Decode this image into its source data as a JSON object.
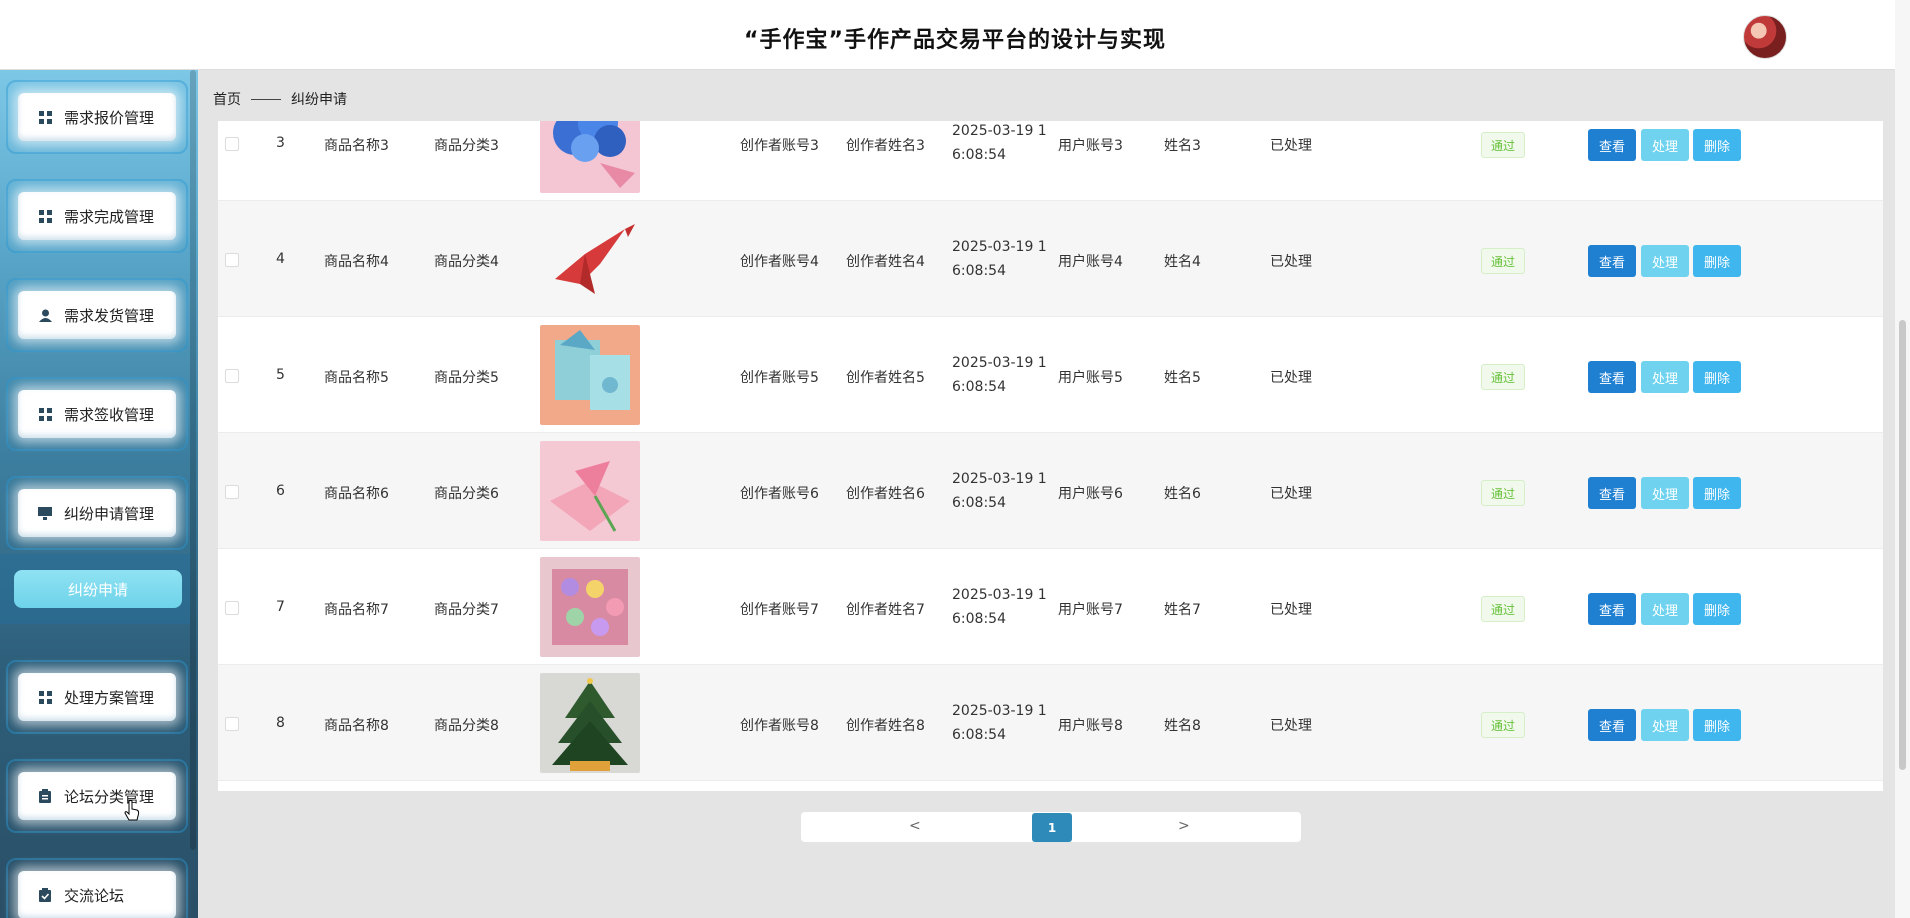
{
  "header": {
    "title": "“手作宝”手作产品交易平台的设计与实现"
  },
  "breadcrumb": {
    "home": "首页",
    "current": "纠纷申请"
  },
  "sidebar": {
    "items": [
      {
        "label": "需求报价管理",
        "icon": "grid-icon"
      },
      {
        "label": "需求完成管理",
        "icon": "grid-icon"
      },
      {
        "label": "需求发货管理",
        "icon": "user-icon"
      },
      {
        "label": "需求签收管理",
        "icon": "grid-icon"
      },
      {
        "label": "纠纷申请管理",
        "icon": "monitor-icon"
      },
      {
        "label": "处理方案管理",
        "icon": "grid-icon"
      },
      {
        "label": "论坛分类管理",
        "icon": "clipboard-icon"
      },
      {
        "label": "交流论坛",
        "icon": "clipboard-check-icon"
      }
    ],
    "active_sub": "纠纷申请"
  },
  "table": {
    "rows": [
      {
        "index": "3",
        "name": "商品名称3",
        "category": "商品分类3",
        "image": "blue-flowers",
        "creator_account": "创作者账号3",
        "creator_name": "创作者姓名3",
        "time1": "2025-03-19 1",
        "time2": "6:08:54",
        "user_account": "用户账号3",
        "user_name": "姓名3",
        "status": "已处理",
        "review": "通过"
      },
      {
        "index": "4",
        "name": "商品名称4",
        "category": "商品分类4",
        "image": "paper-crane",
        "creator_account": "创作者账号4",
        "creator_name": "创作者姓名4",
        "time1": "2025-03-19 1",
        "time2": "6:08:54",
        "user_account": "用户账号4",
        "user_name": "姓名4",
        "status": "已处理",
        "review": "通过"
      },
      {
        "index": "5",
        "name": "商品名称5",
        "category": "商品分类5",
        "image": "origami-cards",
        "creator_account": "创作者账号5",
        "creator_name": "创作者姓名5",
        "time1": "2025-03-19 1",
        "time2": "6:08:54",
        "user_account": "用户账号5",
        "user_name": "姓名5",
        "status": "已处理",
        "review": "通过"
      },
      {
        "index": "6",
        "name": "商品名称6",
        "category": "商品分类6",
        "image": "pink-lily",
        "creator_account": "创作者账号6",
        "creator_name": "创作者姓名6",
        "time1": "2025-03-19 1",
        "time2": "6:08:54",
        "user_account": "用户账号6",
        "user_name": "姓名6",
        "status": "已处理",
        "review": "通过"
      },
      {
        "index": "7",
        "name": "商品名称7",
        "category": "商品分类7",
        "image": "flower-box",
        "creator_account": "创作者账号7",
        "creator_name": "创作者姓名7",
        "time1": "2025-03-19 1",
        "time2": "6:08:54",
        "user_account": "用户账号7",
        "user_name": "姓名7",
        "status": "已处理",
        "review": "通过"
      },
      {
        "index": "8",
        "name": "商品名称8",
        "category": "商品分类8",
        "image": "christmas-tree",
        "creator_account": "创作者账号8",
        "creator_name": "创作者姓名8",
        "time1": "2025-03-19 1",
        "time2": "6:08:54",
        "user_account": "用户账号8",
        "user_name": "姓名8",
        "status": "已处理",
        "review": "通过"
      }
    ],
    "actions": {
      "view": "查看",
      "process": "处理",
      "delete": "删除"
    }
  },
  "pagination": {
    "prev": "<",
    "current": "1",
    "next": ">"
  }
}
